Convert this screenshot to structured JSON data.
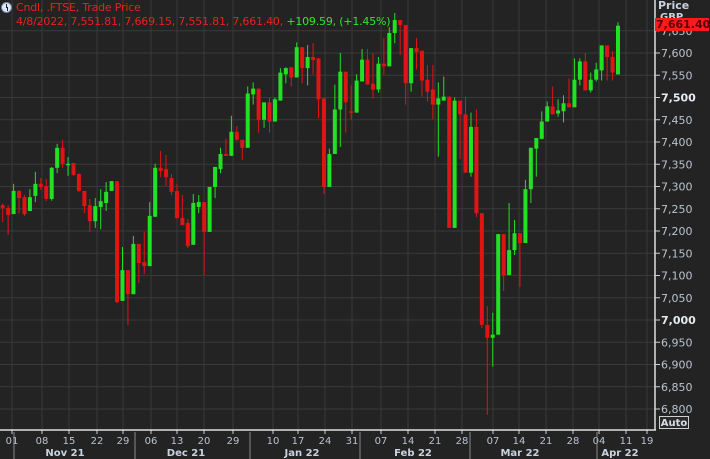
{
  "header": {
    "title": "Cndl, .FTSE, Trade Price",
    "ohlc_line": "4/8/2022, 7,551.81, 7,669.15, 7,551.81, 7,661.40,",
    "change_line": "+109.59, (+1.45%)"
  },
  "axis_panel": {
    "title": "Price",
    "currency": "GBP",
    "last_price_label": "7,661.40",
    "auto_button": "Auto"
  },
  "colors": {
    "background": "#232323",
    "grid": "#3a3a3a",
    "up": "#22e022",
    "down": "#e01414",
    "header_text": "#e8231c",
    "last_price_bg": "#ff1a1a"
  },
  "chart_data": {
    "type": "candlestick",
    "title": "Cndl, .FTSE, Trade Price",
    "ylabel": "Price GBP",
    "ylim": [
      6780,
      7690
    ],
    "grid": true,
    "y_ticks": [
      "7,650",
      "7,600",
      "7,550",
      "7,500",
      "7,450",
      "7,400",
      "7,350",
      "7,300",
      "7,250",
      "7,200",
      "7,150",
      "7,100",
      "7,050",
      "7,000",
      "6,950",
      "6,900",
      "6,850",
      "6,800"
    ],
    "y_tick_values": [
      7650,
      7600,
      7550,
      7500,
      7450,
      7400,
      7350,
      7300,
      7250,
      7200,
      7150,
      7100,
      7050,
      7000,
      6950,
      6900,
      6850,
      6800
    ],
    "bold_ticks": [
      "7,500",
      "7,000"
    ],
    "x_ticks": [
      "01",
      "08",
      "15",
      "22",
      "29",
      "06",
      "13",
      "20",
      "29",
      "10",
      "17",
      "24",
      "31",
      "07",
      "14",
      "21",
      "28",
      "07",
      "14",
      "21",
      "28",
      "04",
      "11",
      "19"
    ],
    "months": [
      "Nov 21",
      "Dec 21",
      "Jan 22",
      "Feb 22",
      "Mar 22",
      "Apr 22"
    ],
    "candle_fields": [
      "open",
      "high",
      "low",
      "close"
    ],
    "candles": [
      [
        7258,
        7262,
        7220,
        7252
      ],
      [
        7252,
        7258,
        7191,
        7236
      ],
      [
        7238,
        7306,
        7238,
        7290
      ],
      [
        7290,
        7292,
        7240,
        7274
      ],
      [
        7276,
        7281,
        7234,
        7238
      ],
      [
        7245,
        7294,
        7245,
        7276
      ],
      [
        7279,
        7333,
        7265,
        7306
      ],
      [
        7306,
        7319,
        7292,
        7299
      ],
      [
        7301,
        7317,
        7267,
        7272
      ],
      [
        7272,
        7344,
        7268,
        7342
      ],
      [
        7342,
        7396,
        7330,
        7387
      ],
      [
        7387,
        7405,
        7342,
        7351
      ],
      [
        7349,
        7366,
        7324,
        7351
      ],
      [
        7353,
        7353,
        7324,
        7326
      ],
      [
        7328,
        7330,
        7288,
        7290
      ],
      [
        7290,
        7290,
        7240,
        7256
      ],
      [
        7258,
        7272,
        7198,
        7222
      ],
      [
        7222,
        7274,
        7207,
        7256
      ],
      [
        7254,
        7294,
        7204,
        7267
      ],
      [
        7263,
        7310,
        7245,
        7288
      ],
      [
        7290,
        7312,
        7290,
        7312
      ],
      [
        7312,
        7312,
        7038,
        7040
      ],
      [
        7043,
        7164,
        7043,
        7112
      ],
      [
        7112,
        7112,
        6989,
        7058
      ],
      [
        7058,
        7189,
        7058,
        7171
      ],
      [
        7171,
        7171,
        7083,
        7128
      ],
      [
        7130,
        7198,
        7103,
        7121
      ],
      [
        7121,
        7265,
        7121,
        7234
      ],
      [
        7232,
        7351,
        7232,
        7342
      ],
      [
        7342,
        7380,
        7321,
        7335
      ],
      [
        7339,
        7371,
        7301,
        7321
      ],
      [
        7319,
        7328,
        7281,
        7288
      ],
      [
        7290,
        7306,
        7227,
        7229
      ],
      [
        7229,
        7281,
        7213,
        7213
      ],
      [
        7218,
        7227,
        7162,
        7166
      ],
      [
        7169,
        7283,
        7169,
        7263
      ],
      [
        7254,
        7281,
        7240,
        7265
      ],
      [
        7265,
        7265,
        7101,
        7198
      ],
      [
        7198,
        7299,
        7198,
        7299
      ],
      [
        7299,
        7344,
        7274,
        7344
      ],
      [
        7339,
        7387,
        7330,
        7373
      ],
      [
        7373,
        7407,
        7369,
        7369
      ],
      [
        7369,
        7459,
        7369,
        7423
      ],
      [
        7423,
        7436,
        7403,
        7405
      ],
      [
        7405,
        7405,
        7360,
        7387
      ],
      [
        7387,
        7525,
        7387,
        7509
      ],
      [
        7507,
        7534,
        7484,
        7520
      ],
      [
        7520,
        7520,
        7421,
        7450
      ],
      [
        7450,
        7489,
        7432,
        7489
      ],
      [
        7489,
        7500,
        7421,
        7446
      ],
      [
        7446,
        7500,
        7446,
        7496
      ],
      [
        7493,
        7566,
        7493,
        7556
      ],
      [
        7552,
        7568,
        7532,
        7566
      ],
      [
        7568,
        7568,
        7525,
        7545
      ],
      [
        7545,
        7624,
        7545,
        7613
      ],
      [
        7613,
        7613,
        7532,
        7566
      ],
      [
        7566,
        7618,
        7527,
        7591
      ],
      [
        7591,
        7622,
        7552,
        7584
      ],
      [
        7588,
        7588,
        7453,
        7496
      ],
      [
        7498,
        7498,
        7283,
        7299
      ],
      [
        7299,
        7385,
        7299,
        7373
      ],
      [
        7373,
        7529,
        7373,
        7473
      ],
      [
        7473,
        7600,
        7389,
        7558
      ],
      [
        7558,
        7558,
        7421,
        7489
      ],
      [
        7469,
        7527,
        7450,
        7466
      ],
      [
        7466,
        7552,
        7466,
        7538
      ],
      [
        7536,
        7609,
        7536,
        7585
      ],
      [
        7585,
        7609,
        7529,
        7529
      ],
      [
        7531,
        7600,
        7498,
        7518
      ],
      [
        7518,
        7591,
        7511,
        7576
      ],
      [
        7576,
        7634,
        7552,
        7570
      ],
      [
        7570,
        7658,
        7570,
        7645
      ],
      [
        7645,
        7690,
        7622,
        7674
      ],
      [
        7674,
        7674,
        7596,
        7663
      ],
      [
        7663,
        7663,
        7484,
        7532
      ],
      [
        7532,
        7611,
        7513,
        7611
      ],
      [
        7611,
        7634,
        7563,
        7602
      ],
      [
        7605,
        7605,
        7502,
        7538
      ],
      [
        7540,
        7573,
        7491,
        7513
      ],
      [
        7518,
        7573,
        7451,
        7484
      ],
      [
        7484,
        7534,
        7367,
        7498
      ],
      [
        7493,
        7547,
        7493,
        7502
      ],
      [
        7502,
        7502,
        7207,
        7207
      ],
      [
        7207,
        7500,
        7207,
        7493
      ],
      [
        7493,
        7493,
        7362,
        7462
      ],
      [
        7462,
        7502,
        7331,
        7331
      ],
      [
        7331,
        7466,
        7322,
        7434
      ],
      [
        7434,
        7473,
        7231,
        7240
      ],
      [
        7240,
        7240,
        6982,
        6989
      ],
      [
        6989,
        7031,
        6787,
        6960
      ],
      [
        6960,
        7016,
        6895,
        6967
      ],
      [
        6967,
        7193,
        6967,
        7193
      ],
      [
        7193,
        7193,
        7065,
        7101
      ],
      [
        7101,
        7263,
        7101,
        7157
      ],
      [
        7157,
        7225,
        7146,
        7195
      ],
      [
        7195,
        7195,
        7074,
        7173
      ],
      [
        7173,
        7315,
        7173,
        7294
      ],
      [
        7294,
        7387,
        7263,
        7387
      ],
      [
        7385,
        7409,
        7322,
        7409
      ],
      [
        7407,
        7469,
        7407,
        7446
      ],
      [
        7446,
        7491,
        7446,
        7480
      ],
      [
        7480,
        7525,
        7462,
        7462
      ],
      [
        7464,
        7496,
        7457,
        7471
      ],
      [
        7469,
        7505,
        7444,
        7487
      ],
      [
        7487,
        7543,
        7478,
        7478
      ],
      [
        7478,
        7588,
        7478,
        7540
      ],
      [
        7540,
        7588,
        7527,
        7581
      ],
      [
        7581,
        7600,
        7516,
        7516
      ],
      [
        7516,
        7556,
        7511,
        7540
      ],
      [
        7540,
        7578,
        7536,
        7563
      ],
      [
        7561,
        7617,
        7538,
        7617
      ],
      [
        7617,
        7617,
        7538,
        7591
      ],
      [
        7591,
        7604,
        7538,
        7556
      ],
      [
        7551.81,
        7669.15,
        7551.81,
        7661.4
      ]
    ]
  }
}
